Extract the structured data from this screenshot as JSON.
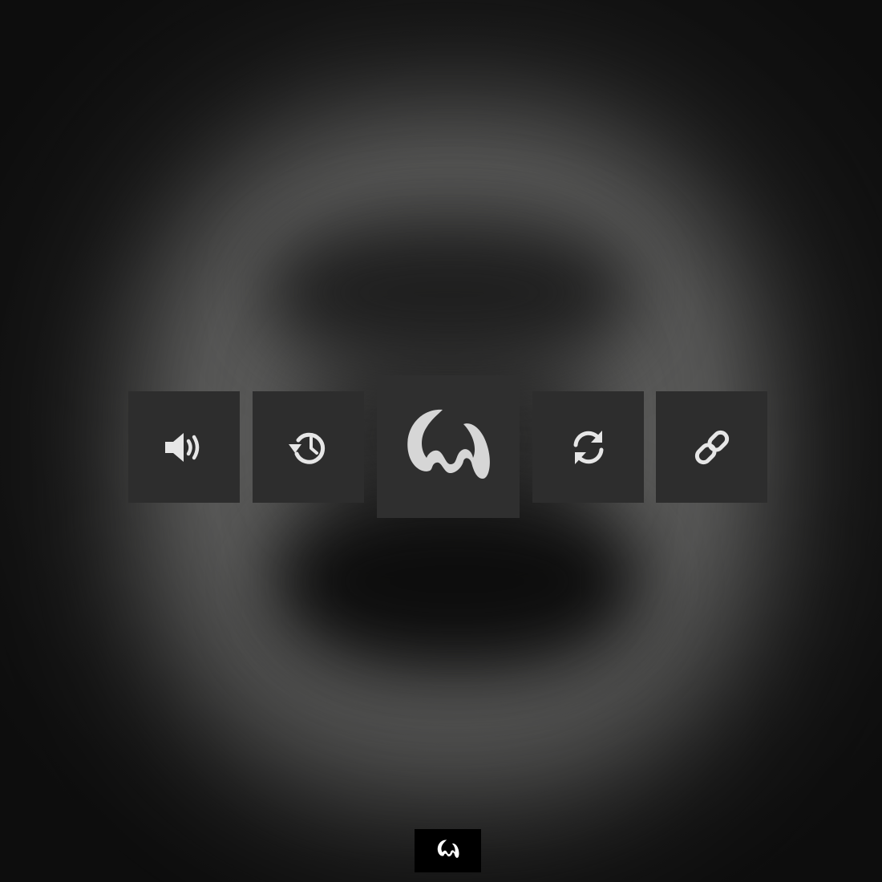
{
  "player": {
    "controls": [
      {
        "id": "volume",
        "icon": "volume-icon",
        "label": ""
      },
      {
        "id": "history",
        "icon": "history-icon",
        "label": ""
      },
      {
        "id": "logo",
        "icon": "logo-icon",
        "label": ""
      },
      {
        "id": "refresh",
        "icon": "refresh-icon",
        "label": ""
      },
      {
        "id": "link",
        "icon": "link-icon",
        "label": ""
      }
    ],
    "footer": {
      "icon": "logo-icon"
    }
  },
  "colors": {
    "background": "#1c1c1c",
    "button": "#2d2d2d",
    "button_large": "#2f2f2f",
    "icon": "#e6e6e6",
    "logo": "#d6d6d6",
    "footer_bg": "#000000"
  }
}
